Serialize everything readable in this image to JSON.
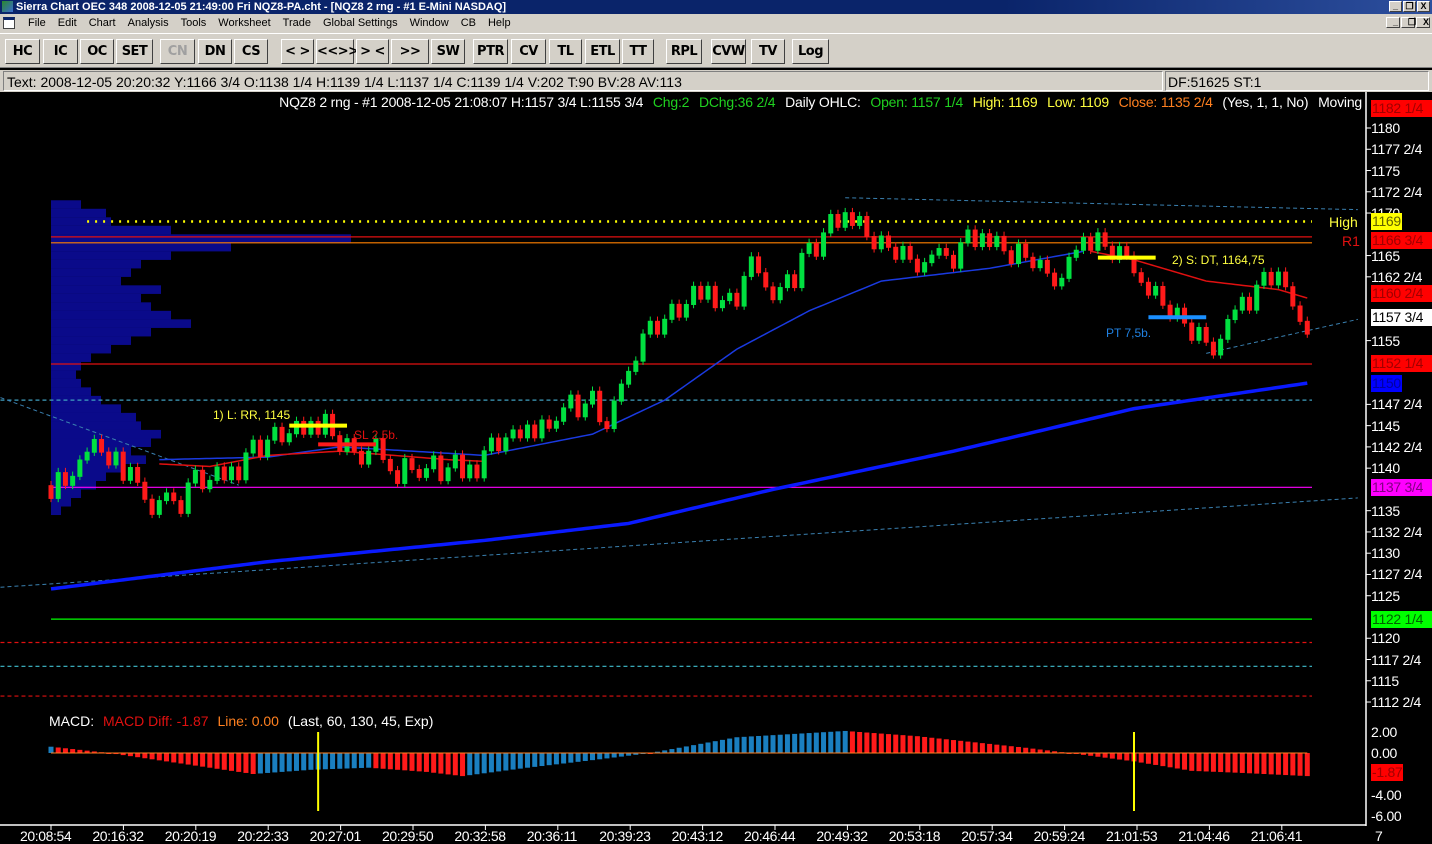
{
  "window": {
    "title": "Sierra Chart OEC 348  2008-12-05  21:49:00  Fri   NQZ8-PA.cht - [NQZ8  2 rng - #1 E-Mini NASDAQ]",
    "controls": [
      "_",
      "❐",
      "X"
    ]
  },
  "menu": [
    "File",
    "Edit",
    "Chart",
    "Analysis",
    "Tools",
    "Worksheet",
    "Trade",
    "Global Settings",
    "Window",
    "CB",
    "Help"
  ],
  "toolbar": [
    {
      "label": "HC",
      "enabled": true
    },
    {
      "label": "IC",
      "enabled": true
    },
    {
      "label": "OC",
      "enabled": true
    },
    {
      "label": "SET",
      "enabled": true
    },
    {
      "label": "CN",
      "enabled": false
    },
    {
      "label": "DN",
      "enabled": true
    },
    {
      "label": "CS",
      "enabled": true
    },
    {
      "label": "< >",
      "enabled": true
    },
    {
      "label": "<<>>",
      "enabled": true
    },
    {
      "label": "> <",
      "enabled": true
    },
    {
      "label": ">><<",
      "enabled": true
    },
    {
      "label": "SW",
      "enabled": true
    },
    {
      "label": "PTR",
      "enabled": true
    },
    {
      "label": "CV",
      "enabled": true
    },
    {
      "label": "TL",
      "enabled": true
    },
    {
      "label": "ETL",
      "enabled": true
    },
    {
      "label": "TT",
      "enabled": true
    },
    {
      "label": "RPL",
      "enabled": true
    },
    {
      "label": "CVW",
      "enabled": true
    },
    {
      "label": "TV",
      "enabled": true
    },
    {
      "label": "Log",
      "enabled": true
    }
  ],
  "infobar": {
    "text": "Text: 2008-12-05  20:20:32  Y:1166 3/4  O:1138 1/4  H:1139 1/4  L:1137 1/4  C:1139 1/4  V:202  T:90  BV:28  AV:113",
    "right": "DF:51625  ST:1"
  },
  "chart_header": {
    "symbol": "NQZ8  2 rng - #1  2008-12-05  21:08:07  H:1157 3/4  L:1155 3/4",
    "chg": "Chg:2",
    "dchg": "DChg:36 2/4",
    "ohlc_label": "Daily OHLC:",
    "open": "Open: 1157 1/4",
    "high": "High: 1169",
    "low": "Low: 1109",
    "close": "Close: 1135 2/4",
    "params": "(Yes, 1, 1, No)",
    "moving": "Moving"
  },
  "colors": {
    "up": "#00e040",
    "down": "#ff1a1a",
    "ma_slow": "#0a1aff",
    "ma_fast": "#1a3ae0",
    "ma_red": "#e01010",
    "profile": "#0a0a8a",
    "macd_up": "#1a7fc0",
    "macd_down": "#ff1a1a"
  },
  "chart_data": {
    "type": "candlestick",
    "bar_range": 2,
    "price_axis": {
      "min": 1112.5,
      "max": 1182.25,
      "ticks": [
        "1180",
        "1177 2/4",
        "1175",
        "1172 2/4",
        "1170",
        "1165",
        "1162 2/4",
        "1155",
        "1147 2/4",
        "1145",
        "1142 2/4",
        "1140",
        "1135",
        "1132 2/4",
        "1130",
        "1127 2/4",
        "1125",
        "1120",
        "1117 2/4",
        "1115",
        "1112 2/4"
      ],
      "tick_values": [
        1180,
        1177.5,
        1175,
        1172.5,
        1170,
        1165,
        1162.5,
        1155,
        1147.5,
        1145,
        1142.5,
        1140,
        1135,
        1132.5,
        1130,
        1127.5,
        1125,
        1120,
        1117.5,
        1115,
        1112.5
      ]
    },
    "price_tags": [
      {
        "label": "1182 1/4",
        "value": 1182.25,
        "bg": "#ff0000",
        "fg": "#a00000"
      },
      {
        "label": "1169",
        "value": 1169,
        "bg": "#ffff00",
        "fg": "#606000"
      },
      {
        "label": "1166 3/4",
        "value": 1166.75,
        "bg": "#ff0000",
        "fg": "#a00000"
      },
      {
        "label": "1160 2/4",
        "value": 1160.5,
        "bg": "#ff0000",
        "fg": "#a00000"
      },
      {
        "label": "1157 3/4",
        "value": 1157.75,
        "bg": "#ffffff",
        "fg": "#000000"
      },
      {
        "label": "1152 1/4",
        "value": 1152.25,
        "bg": "#ff0000",
        "fg": "#a00000"
      },
      {
        "label": "1150",
        "value": 1150,
        "bg": "#0000ff",
        "fg": "#0000a0"
      },
      {
        "label": "1137 3/4",
        "value": 1137.75,
        "bg": "#ff00ff",
        "fg": "#800080"
      },
      {
        "label": "1122 1/4",
        "value": 1122.25,
        "bg": "#00ff00",
        "fg": "#006000"
      }
    ],
    "time_labels": [
      "20:08:54",
      "20:16:32",
      "20:20:19",
      "20:22:33",
      "20:27:01",
      "20:29:50",
      "20:32:58",
      "20:36:11",
      "20:39:23",
      "20:43:12",
      "20:46:44",
      "20:49:32",
      "20:53:18",
      "20:57:34",
      "20:59:24",
      "21:01:53",
      "21:04:46",
      "21:06:41"
    ],
    "time_axis_end": "7",
    "price_path": [
      [
        0,
        1138
      ],
      [
        7,
        1142.5
      ],
      [
        14,
        1135.5
      ],
      [
        27,
        1141
      ],
      [
        33,
        1144.5
      ],
      [
        38,
        1145.5
      ],
      [
        41,
        1141.5
      ],
      [
        48,
        1140.5
      ],
      [
        57,
        1138.5
      ],
      [
        62,
        1143
      ],
      [
        73,
        1147
      ],
      [
        77,
        1145.5
      ],
      [
        82,
        1155
      ],
      [
        89,
        1161
      ],
      [
        93,
        1159
      ],
      [
        97,
        1164
      ],
      [
        101,
        1160.5
      ],
      [
        105,
        1166
      ],
      [
        110,
        1171
      ],
      [
        115,
        1165.5
      ],
      [
        123,
        1165
      ],
      [
        130,
        1167.5
      ],
      [
        136,
        1164.5
      ],
      [
        140,
        1163
      ],
      [
        144,
        1167.5
      ],
      [
        150,
        1163.5
      ],
      [
        154,
        1160
      ],
      [
        160,
        1154
      ],
      [
        165,
        1159
      ],
      [
        169,
        1162.5
      ],
      [
        171,
        1160.5
      ],
      [
        174,
        1157
      ]
    ],
    "levels": [
      {
        "name": "High",
        "label": "High",
        "value": 1169,
        "color": "#ffff00",
        "style": "dotted",
        "from": 5,
        "label_color": "#ffff00"
      },
      {
        "name": "R1",
        "label": "R1",
        "value": 1166.5,
        "color": "#ff8000",
        "style": "solid",
        "from": 0,
        "label_color": "#e01010"
      },
      {
        "name": "red-level",
        "value": 1167.2,
        "color": "#e01010",
        "style": "solid",
        "from": 0
      },
      {
        "name": "red-level-2",
        "value": 1152.25,
        "color": "#e01010",
        "style": "solid",
        "from": 0
      },
      {
        "name": "cyan-level",
        "value": 1148,
        "color": "#40a0c0",
        "style": "dashed",
        "from": -7
      },
      {
        "name": "magenta-level",
        "value": 1137.75,
        "color": "#ff00ff",
        "style": "solid",
        "from": 0
      },
      {
        "name": "green-level",
        "value": 1122.25,
        "color": "#00ff00",
        "style": "solid",
        "from": 0
      },
      {
        "name": "red-dashed-1",
        "value": 1119.5,
        "color": "#e01010",
        "style": "dashed",
        "from": -7
      },
      {
        "name": "cyan-dashed",
        "value": 1116.7,
        "color": "#40c0d0",
        "style": "dashed",
        "from": -7
      },
      {
        "name": "red-dashed-2",
        "value": 1113.2,
        "color": "#e01010",
        "style": "dashed",
        "from": -7
      }
    ],
    "trendlines": [
      [
        [
          -7,
          1126
        ],
        [
          181,
          1136.5
        ]
      ],
      [
        [
          -7,
          1148.3
        ],
        [
          26,
          1138
        ]
      ],
      [
        [
          110,
          1171.8
        ],
        [
          181,
          1170.4
        ]
      ],
      [
        [
          160,
          1153.5
        ],
        [
          181,
          1157.5
        ]
      ]
    ],
    "ma_slow": [
      [
        0,
        1125.8
      ],
      [
        30,
        1129
      ],
      [
        60,
        1131.5
      ],
      [
        80,
        1133.5
      ],
      [
        100,
        1137.5
      ],
      [
        125,
        1142
      ],
      [
        150,
        1147
      ],
      [
        174,
        1150
      ]
    ],
    "ma_fast": [
      [
        15,
        1141
      ],
      [
        30,
        1141.3
      ],
      [
        40,
        1142.5
      ],
      [
        60,
        1141.5
      ],
      [
        75,
        1144
      ],
      [
        85,
        1148
      ],
      [
        95,
        1154
      ],
      [
        105,
        1158.5
      ],
      [
        115,
        1162
      ],
      [
        130,
        1163.5
      ],
      [
        143,
        1165.5
      ]
    ],
    "ma_red": [
      [
        15,
        1140.5
      ],
      [
        22,
        1140.2
      ],
      [
        30,
        1141.5
      ],
      [
        40,
        1142
      ],
      [
        55,
        1141
      ],
      [
        60,
        1140.8
      ]
    ],
    "ma_red_2": [
      [
        144,
        1165.5
      ],
      [
        150,
        1164.5
      ],
      [
        160,
        1162
      ],
      [
        170,
        1161
      ],
      [
        174,
        1160
      ]
    ],
    "volume_profile": [
      [
        1171,
        30
      ],
      [
        1170,
        55
      ],
      [
        1169,
        60
      ],
      [
        1168,
        120
      ],
      [
        1167,
        300
      ],
      [
        1166,
        180
      ],
      [
        1165,
        120
      ],
      [
        1164,
        90
      ],
      [
        1163,
        80
      ],
      [
        1162,
        70
      ],
      [
        1161,
        110
      ],
      [
        1160,
        90
      ],
      [
        1159,
        100
      ],
      [
        1158,
        120
      ],
      [
        1157,
        140
      ],
      [
        1156,
        100
      ],
      [
        1155,
        80
      ],
      [
        1154,
        60
      ],
      [
        1153,
        40
      ],
      [
        1152,
        30
      ],
      [
        1151,
        25
      ],
      [
        1150,
        30
      ],
      [
        1149,
        40
      ],
      [
        1148,
        50
      ],
      [
        1147,
        70
      ],
      [
        1146,
        85
      ],
      [
        1145,
        90
      ],
      [
        1144,
        110
      ],
      [
        1143,
        100
      ],
      [
        1142,
        80
      ],
      [
        1141,
        95
      ],
      [
        1140,
        70
      ],
      [
        1139,
        55
      ],
      [
        1138,
        45
      ],
      [
        1137,
        30
      ],
      [
        1136,
        20
      ],
      [
        1135,
        10
      ]
    ],
    "annotations": [
      {
        "text": "1) L: RR, 1145",
        "color": "#ffff40"
      },
      {
        "text": "SL 2,5b.",
        "color": "#e01010"
      },
      {
        "text": "2) S: DT, 1164,75",
        "color": "#ffff40"
      },
      {
        "text": "PT 7,5b.",
        "color": "#2080e0"
      }
    ],
    "trade_marks": [
      {
        "bar0": 33,
        "bar1": 41,
        "price": 1145,
        "color": "#ffff00"
      },
      {
        "bar0": 37,
        "bar1": 45,
        "price": 1142.8,
        "color": "#ff1a1a"
      },
      {
        "bar0": 145,
        "bar1": 153,
        "price": 1164.75,
        "color": "#ffff00"
      },
      {
        "bar0": 152,
        "bar1": 160,
        "price": 1157.75,
        "color": "#1a8fff"
      }
    ],
    "macd": {
      "label": "MACD:",
      "diff": "MACD Diff: -1.87",
      "line": "Line: 0.00",
      "params": "(Last, 60, 130, 45, Exp)",
      "axis": [
        "2.00",
        "0.00",
        "-4.00",
        "-6.00"
      ],
      "axis_values": [
        2,
        0,
        -4,
        -6
      ],
      "tag": "-1.87",
      "tag_value": -1.87,
      "path": [
        [
          0,
          0.6
        ],
        [
          8,
          0
        ],
        [
          20,
          -1.2
        ],
        [
          28,
          -2
        ],
        [
          36,
          -1.6
        ],
        [
          44,
          -1.4
        ],
        [
          52,
          -1.8
        ],
        [
          57,
          -2.2
        ],
        [
          66,
          -1.4
        ],
        [
          76,
          -0.6
        ],
        [
          83,
          0
        ],
        [
          95,
          1.5
        ],
        [
          110,
          2.1
        ],
        [
          120,
          1.6
        ],
        [
          135,
          0.5
        ],
        [
          141,
          0
        ],
        [
          150,
          -0.8
        ],
        [
          158,
          -1.7
        ],
        [
          165,
          -1.9
        ],
        [
          174,
          -2.2
        ]
      ],
      "markers": [
        37,
        150
      ]
    }
  }
}
